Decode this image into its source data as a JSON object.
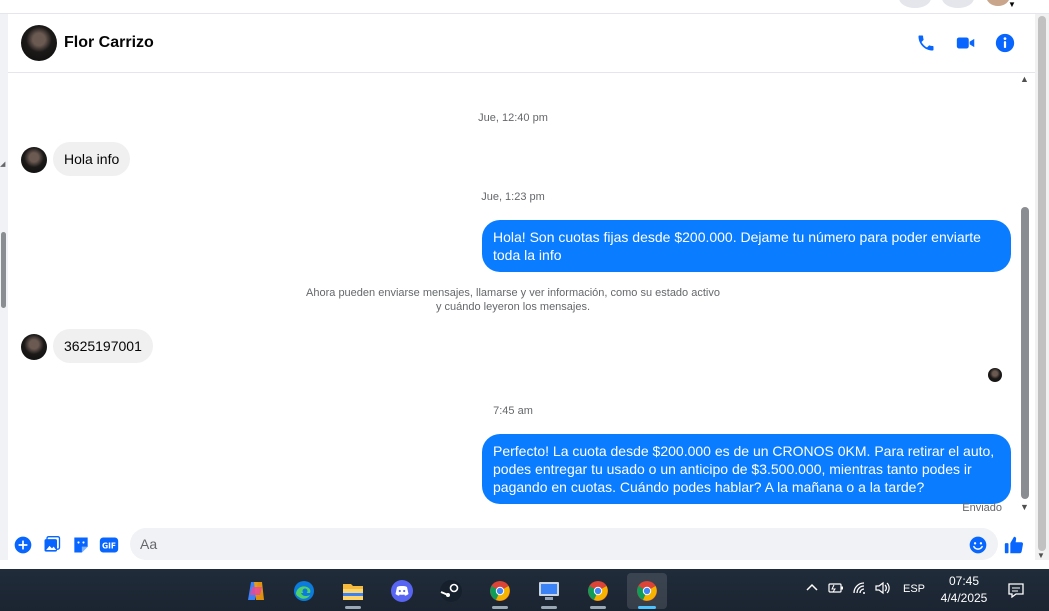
{
  "contact": {
    "name": "Flor Carrizo"
  },
  "header": {
    "icons": [
      "phone-icon",
      "video-camera-icon",
      "info-icon"
    ]
  },
  "messages": {
    "ts1": "Jue, 12:40 pm",
    "in1": "Hola info",
    "ts2": "Jue, 1:23 pm",
    "out1": "Hola! Son cuotas fijas desde $200.000. Dejame tu número para poder enviarte toda la info",
    "notice_line1": "Ahora pueden enviarse mensajes, llamarse y ver información, como su estado activo",
    "notice_line2": "y cuándo leyeron los mensajes.",
    "in2": "3625197001",
    "ts3": "7:45 am",
    "out2": "Perfecto! La cuota desde $200.000 es de un CRONOS 0KM. Para retirar el auto, podes entregar tu usado o un anticipo de $3.500.000, mientras tanto podes ir pagando en cuotas. Cuándo podes hablar? A la mañana o a la tarde?",
    "status": "Enviado"
  },
  "composer": {
    "placeholder": "Aa",
    "gif_label": "GIF",
    "icons": [
      "plus-circle-icon",
      "photo-icon",
      "sticker-icon",
      "gif-icon",
      "emoji-icon",
      "thumbs-up-icon"
    ]
  },
  "taskbar": {
    "apps": [
      "copilot-icon",
      "edge-icon",
      "file-explorer-icon",
      "discord-icon",
      "steam-icon",
      "chrome-icon",
      "network-tool-icon",
      "chrome-icon",
      "chrome-icon"
    ],
    "language": "ESP",
    "time": "07:45",
    "date": "4/4/2025"
  },
  "colors": {
    "accent": "#0a7cff",
    "icon_blue": "#0866ff",
    "incoming_bubble": "#f0f0f0",
    "taskbar": "#1f2a37"
  }
}
